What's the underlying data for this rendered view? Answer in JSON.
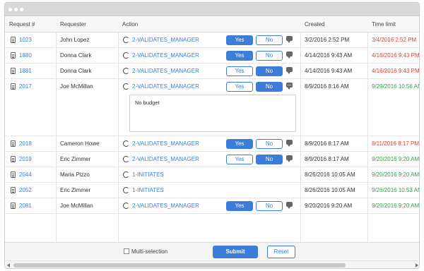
{
  "columns": {
    "request": "Request #",
    "requester": "Requester",
    "action": "Action",
    "created": "Created",
    "time_limit": "Time limit"
  },
  "rows": [
    {
      "request": "1023",
      "requester": "John Lopez",
      "action": "2-VALIDATES_MANAGER",
      "yes": "Yes",
      "no": "No",
      "selected": "yes",
      "created": "3/2/2016 2:52 PM",
      "time_limit": "3/4/2016 2:52 PM",
      "time_color": "red"
    },
    {
      "request": "1880",
      "requester": "Donna Clark",
      "action": "2-VALIDATES_MANAGER",
      "yes": "Yes",
      "no": "No",
      "selected": "yes",
      "created": "4/14/2016 9:43 AM",
      "time_limit": "4/16/2016 9:43 PM",
      "time_color": "red"
    },
    {
      "request": "1881",
      "requester": "Donna Clark",
      "action": "2-VALIDATES_MANAGER",
      "yes": "Yes",
      "no": "No",
      "selected": "no",
      "created": "4/14/2016 9:43 AM",
      "time_limit": "4/16/2016 9:43 PM",
      "time_color": "red"
    },
    {
      "request": "2017",
      "requester": "Joe McMillan",
      "action": "2-VALIDATES_MANAGER",
      "yes": "Yes",
      "no": "No",
      "selected": "no",
      "created": "8/9/2016 8:16 AM",
      "time_limit": "9/29/2016 10:56 AM",
      "time_color": "green",
      "comment": "No budget"
    },
    {
      "request": "2018",
      "requester": "Cameron Howe",
      "action": "2-VALIDATES_MANAGER",
      "yes": "Yes",
      "no": "No",
      "selected": "yes",
      "created": "8/9/2016 8:17 AM",
      "time_limit": "8/11/2016 8:17 PM",
      "time_color": "red"
    },
    {
      "request": "2019",
      "requester": "Eric Zimmer",
      "action": "2-VALIDATES_MANAGER",
      "yes": "Yes",
      "no": "No",
      "selected": "no",
      "created": "8/9/2016 8:17 AM",
      "time_limit": "9/20/2016 9:20 AM",
      "time_color": "green"
    },
    {
      "request": "2044",
      "requester": "Maria Pizzo",
      "action": "1-INITIATES",
      "created": "8/26/2016 10:05 AM",
      "time_limit": "9/20/2016 9:20 AM",
      "time_color": "green"
    },
    {
      "request": "2052",
      "requester": "Eric Zimmer",
      "action": "1-INITIATES",
      "created": "8/26/2016 10:05 AM",
      "time_limit": "9/26/2016 10:53 AM",
      "time_color": "green"
    },
    {
      "request": "2081",
      "requester": "Joe McMillan",
      "action": "2-VALIDATES_MANAGER",
      "yes": "Yes",
      "no": "No",
      "selected": "yes",
      "created": "9/20/2016 9:20 AM",
      "time_limit": "9/20/2016 9:20 AM",
      "time_color": "green"
    }
  ],
  "footer": {
    "multi_selection": "Multi-selection",
    "submit": "Submit",
    "reset": "Reset"
  },
  "colors": {
    "accent": "#3b7dd8",
    "red": "#e53935",
    "green": "#2e9e48"
  }
}
